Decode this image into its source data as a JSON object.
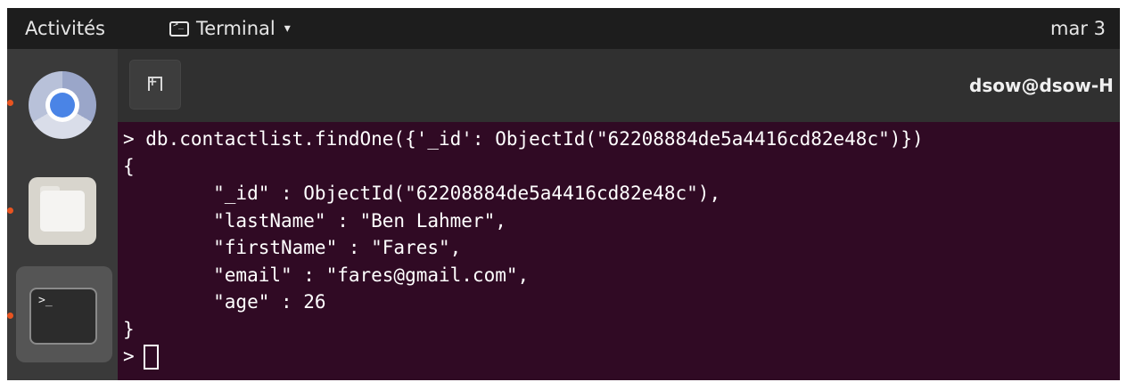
{
  "topbar": {
    "activities": "Activités",
    "app_menu_label": "Terminal",
    "app_menu_caret": "▾",
    "clock": "mar 3"
  },
  "dock": {
    "items": [
      {
        "name": "Chromium",
        "running": true,
        "icon": "chromium-icon"
      },
      {
        "name": "Files",
        "running": true,
        "icon": "folder-icon"
      },
      {
        "name": "Terminal",
        "running": true,
        "active": true,
        "icon": "terminal-icon",
        "glyph": ">_"
      }
    ]
  },
  "terminal": {
    "title": "dsow@dsow-H",
    "background": "#300a24",
    "lines": [
      "> db.contactlist.findOne({'_id': ObjectId(\"62208884de5a4416cd82e48c\")})",
      "{",
      "        \"_id\" : ObjectId(\"62208884de5a4416cd82e48c\"),",
      "        \"lastName\" : \"Ben Lahmer\",",
      "        \"firstName\" : \"Fares\",",
      "        \"email\" : \"fares@gmail.com\",",
      "        \"age\" : 26",
      "}"
    ],
    "prompt": ">"
  },
  "colors": {
    "accent": "#e95420",
    "topbar": "#1d1d1d",
    "dock": "#3a3a3a"
  }
}
